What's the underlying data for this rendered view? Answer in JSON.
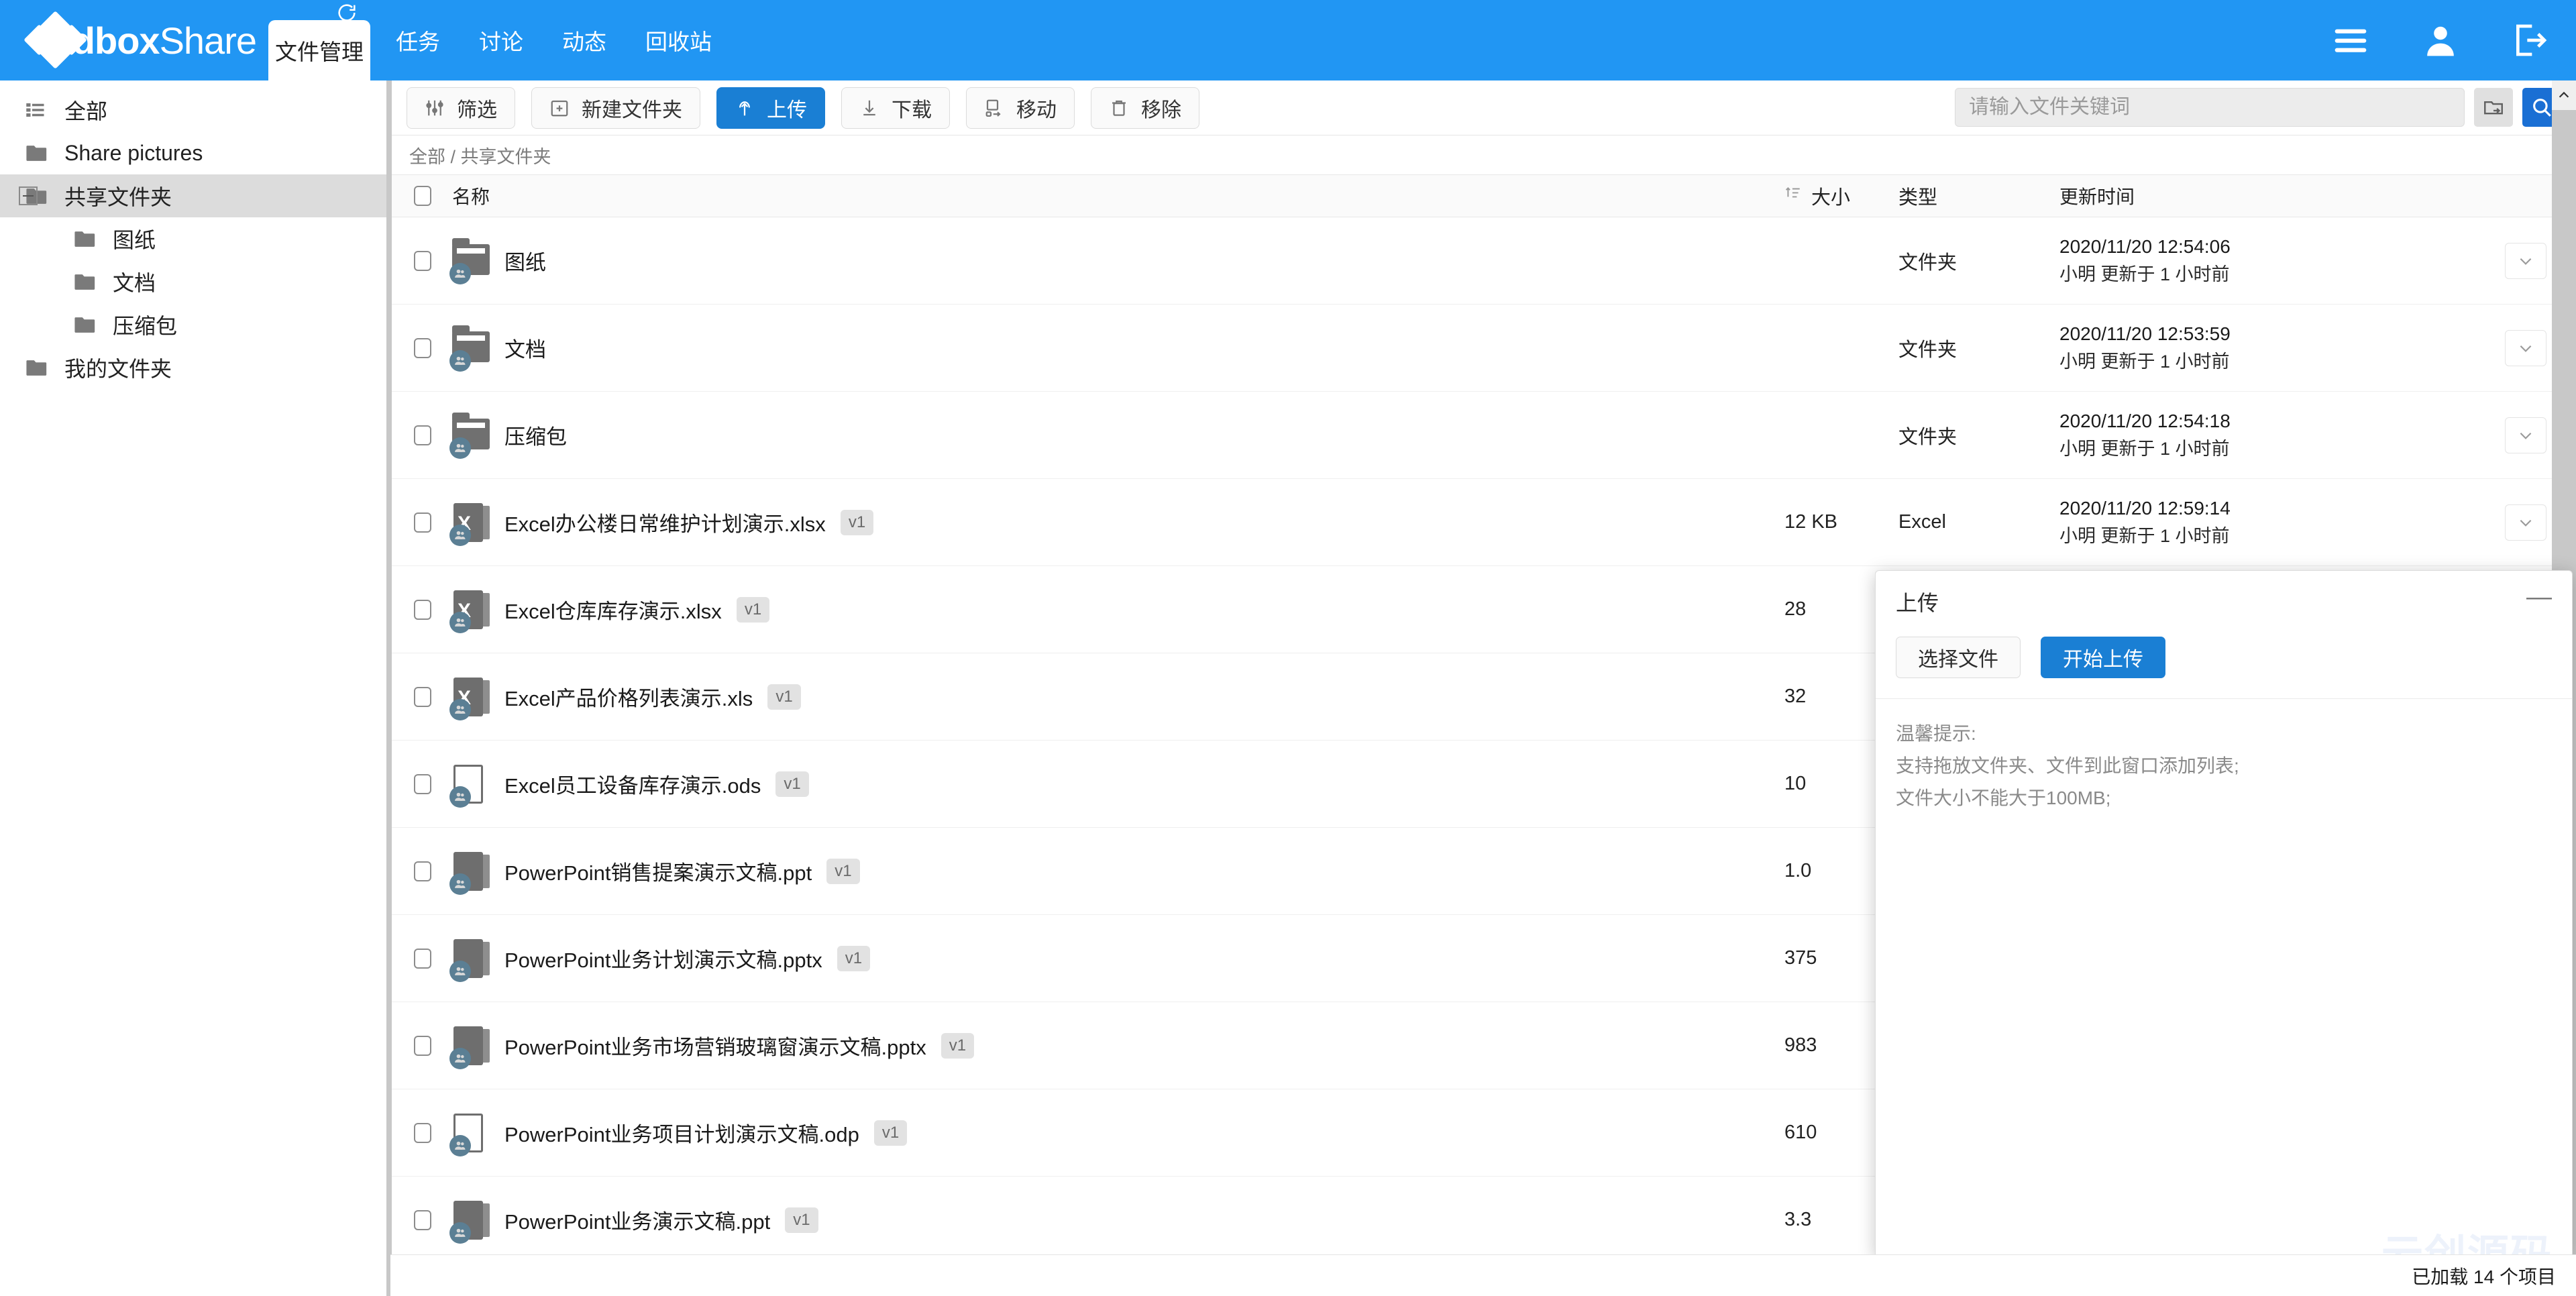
{
  "brand": {
    "bold": "dbox",
    "light": "Share"
  },
  "header": {
    "active_tab": "文件管理",
    "tabs": [
      "任务",
      "讨论",
      "动态",
      "回收站"
    ],
    "icons": {
      "menu": "menu-icon",
      "user": "user-icon",
      "logout": "logout-icon",
      "refresh": "refresh-icon"
    }
  },
  "sidebar": {
    "items": [
      {
        "label": "全部",
        "icon": "list-icon",
        "level": 0,
        "selected": false,
        "expander": false
      },
      {
        "label": "Share pictures",
        "icon": "folder-icon",
        "level": 0,
        "selected": false,
        "expander": false
      },
      {
        "label": "共享文件夹",
        "icon": "folder-icon",
        "level": 0,
        "selected": true,
        "expander": true
      },
      {
        "label": "图纸",
        "icon": "folder-icon",
        "level": 2,
        "selected": false,
        "expander": false
      },
      {
        "label": "文档",
        "icon": "folder-icon",
        "level": 2,
        "selected": false,
        "expander": false
      },
      {
        "label": "压缩包",
        "icon": "folder-icon",
        "level": 2,
        "selected": false,
        "expander": false
      },
      {
        "label": "我的文件夹",
        "icon": "folder-icon",
        "level": 0,
        "selected": false,
        "expander": false
      }
    ]
  },
  "toolbar": {
    "buttons": [
      {
        "label": "筛选",
        "icon": "filter-icon",
        "primary": false
      },
      {
        "label": "新建文件夹",
        "icon": "new-folder-icon",
        "primary": false
      },
      {
        "label": "上传",
        "icon": "upload-icon",
        "primary": true
      },
      {
        "label": "下载",
        "icon": "download-icon",
        "primary": false
      },
      {
        "label": "移动",
        "icon": "move-icon",
        "primary": false
      },
      {
        "label": "移除",
        "icon": "trash-icon",
        "primary": false
      }
    ]
  },
  "search": {
    "placeholder": "请输入文件关键词",
    "value": "",
    "folder_button_icon": "folder-export-icon",
    "search_button_icon": "search-icon"
  },
  "breadcrumb": "全部 / 共享文件夹",
  "table": {
    "columns": {
      "name": "名称",
      "size": "大小",
      "type": "类型",
      "time": "更新时间"
    },
    "sort_icon": "sort-icon",
    "rows": [
      {
        "name": "图纸",
        "version": "",
        "size": "",
        "type": "文件夹",
        "time": "2020/11/20 12:54:06",
        "meta": "小明 更新于 1 小时前",
        "icon": "folder-shared-icon"
      },
      {
        "name": "文档",
        "version": "",
        "size": "",
        "type": "文件夹",
        "time": "2020/11/20 12:53:59",
        "meta": "小明 更新于 1 小时前",
        "icon": "folder-shared-icon"
      },
      {
        "name": "压缩包",
        "version": "",
        "size": "",
        "type": "文件夹",
        "time": "2020/11/20 12:54:18",
        "meta": "小明 更新于 1 小时前",
        "icon": "folder-shared-icon"
      },
      {
        "name": "Excel办公楼日常维护计划演示.xlsx",
        "version": "v1",
        "size": "12 KB",
        "type": "Excel",
        "time": "2020/11/20 12:59:14",
        "meta": "小明 更新于 1 小时前",
        "icon": "excel-icon"
      },
      {
        "name": "Excel仓库库存演示.xlsx",
        "version": "v1",
        "size": "28",
        "type": "",
        "time": "",
        "meta": "",
        "icon": "excel-icon"
      },
      {
        "name": "Excel产品价格列表演示.xls",
        "version": "v1",
        "size": "32",
        "type": "",
        "time": "",
        "meta": "",
        "icon": "excel-icon"
      },
      {
        "name": "Excel员工设备库存演示.ods",
        "version": "v1",
        "size": "10",
        "type": "",
        "time": "",
        "meta": "",
        "icon": "ods-icon"
      },
      {
        "name": "PowerPoint销售提案演示文稿.ppt",
        "version": "v1",
        "size": "1.0",
        "type": "",
        "time": "",
        "meta": "",
        "icon": "powerpoint-icon"
      },
      {
        "name": "PowerPoint业务计划演示文稿.pptx",
        "version": "v1",
        "size": "375",
        "type": "",
        "time": "",
        "meta": "",
        "icon": "powerpoint-icon"
      },
      {
        "name": "PowerPoint业务市场营销玻璃窗演示文稿.pptx",
        "version": "v1",
        "size": "983",
        "type": "",
        "time": "",
        "meta": "",
        "icon": "powerpoint-icon"
      },
      {
        "name": "PowerPoint业务项目计划演示文稿.odp",
        "version": "v1",
        "size": "610",
        "type": "",
        "time": "",
        "meta": "",
        "icon": "odp-icon"
      },
      {
        "name": "PowerPoint业务演示文稿.ppt",
        "version": "v1",
        "size": "3.3",
        "type": "",
        "time": "",
        "meta": "",
        "icon": "powerpoint-icon"
      }
    ]
  },
  "upload_dialog": {
    "title": "上传",
    "minimize_icon": "minimize-icon",
    "choose_label": "选择文件",
    "start_label": "开始上传",
    "tips_title": "温馨提示:",
    "tips": [
      "支持拖放文件夹、文件到此窗口添加列表;",
      "文件大小不能大于100MB;"
    ]
  },
  "status": {
    "loaded_text": "已加载 14 个项目"
  },
  "watermark": "云创源码",
  "colors": {
    "brand_blue": "#2196f3",
    "action_blue": "#1a7fd4",
    "sidebar_selected": "#dcdcdc"
  }
}
